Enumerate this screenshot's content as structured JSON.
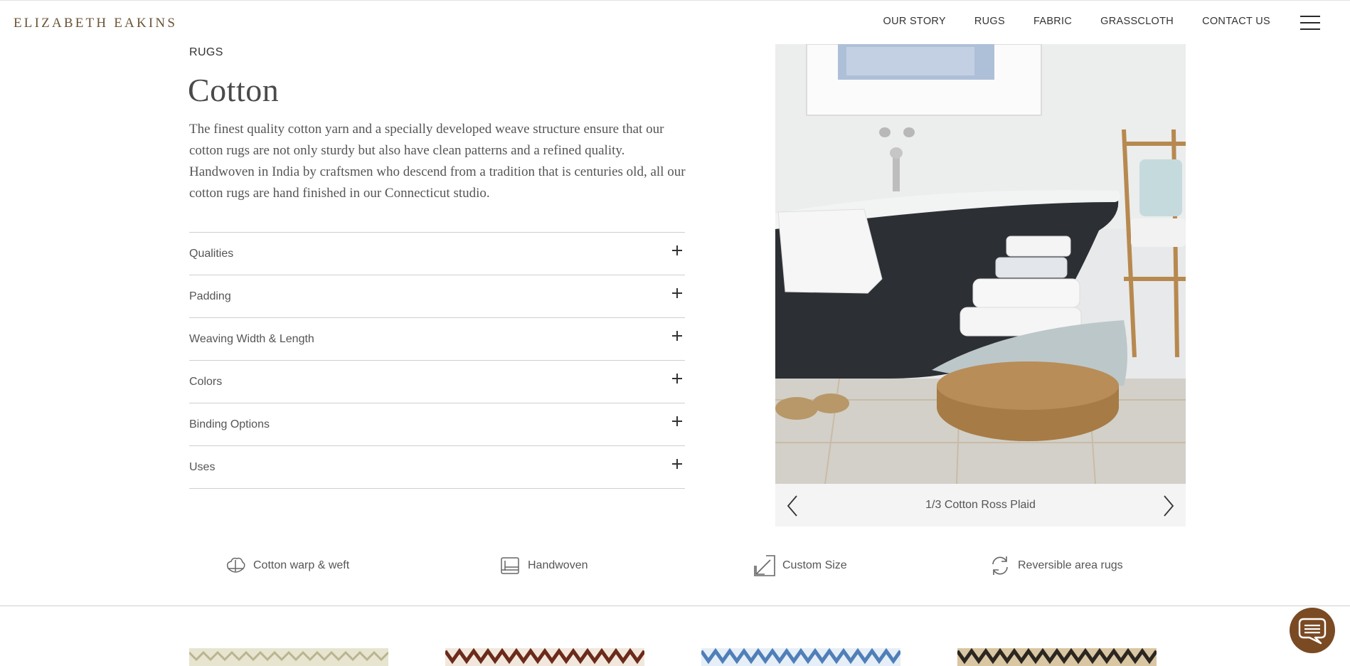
{
  "brand": {
    "logo": "ELIZABETH EAKINS"
  },
  "nav": {
    "items": [
      "OUR STORY",
      "RUGS",
      "FABRIC",
      "GRASSCLOTH",
      "CONTACT US"
    ],
    "menu_icon": "hamburger-icon"
  },
  "page": {
    "breadcrumb": "RUGS",
    "title": "Cotton",
    "description": "The finest quality cotton yarn and a specially developed weave structure ensure that our cotton rugs are not only sturdy but also have clean patterns and a refined quality. Handwoven in India by craftsmen who descend from a tradition that is centuries old, all our cotton rugs are hand finished in our Connecticut studio."
  },
  "accordion": {
    "items": [
      "Qualities",
      "Padding",
      "Weaving Width & Length",
      "Colors",
      "Binding Options",
      "Uses"
    ],
    "expand_icon": "plus-icon"
  },
  "carousel": {
    "caption": "1/3 Cotton Ross Plaid",
    "prev_icon": "chevron-left-icon",
    "next_icon": "chevron-right-icon"
  },
  "features": [
    {
      "label": "Cotton warp & weft",
      "icon": "cotton-icon"
    },
    {
      "label": "Handwoven",
      "icon": "loom-icon"
    },
    {
      "label": "Custom Size",
      "icon": "resize-arrow-icon"
    },
    {
      "label": "Reversible area rugs",
      "icon": "refresh-icon"
    }
  ],
  "swatches": [
    {
      "name": "swatch-1",
      "colors": [
        "#c9c6a8",
        "#e7e4cf"
      ]
    },
    {
      "name": "swatch-2",
      "colors": [
        "#6b2a1a",
        "#f1e7dc"
      ]
    },
    {
      "name": "swatch-3",
      "colors": [
        "#4f7fb8",
        "#e6eef7"
      ]
    },
    {
      "name": "swatch-4",
      "colors": [
        "#2b2620",
        "#d9c6a2"
      ]
    }
  ],
  "colors": {
    "brand": "#6b5436",
    "chat_button": "#7a4a23",
    "caption_bar": "#f4f4f4"
  },
  "chat": {
    "icon": "chat-bubble-icon"
  }
}
